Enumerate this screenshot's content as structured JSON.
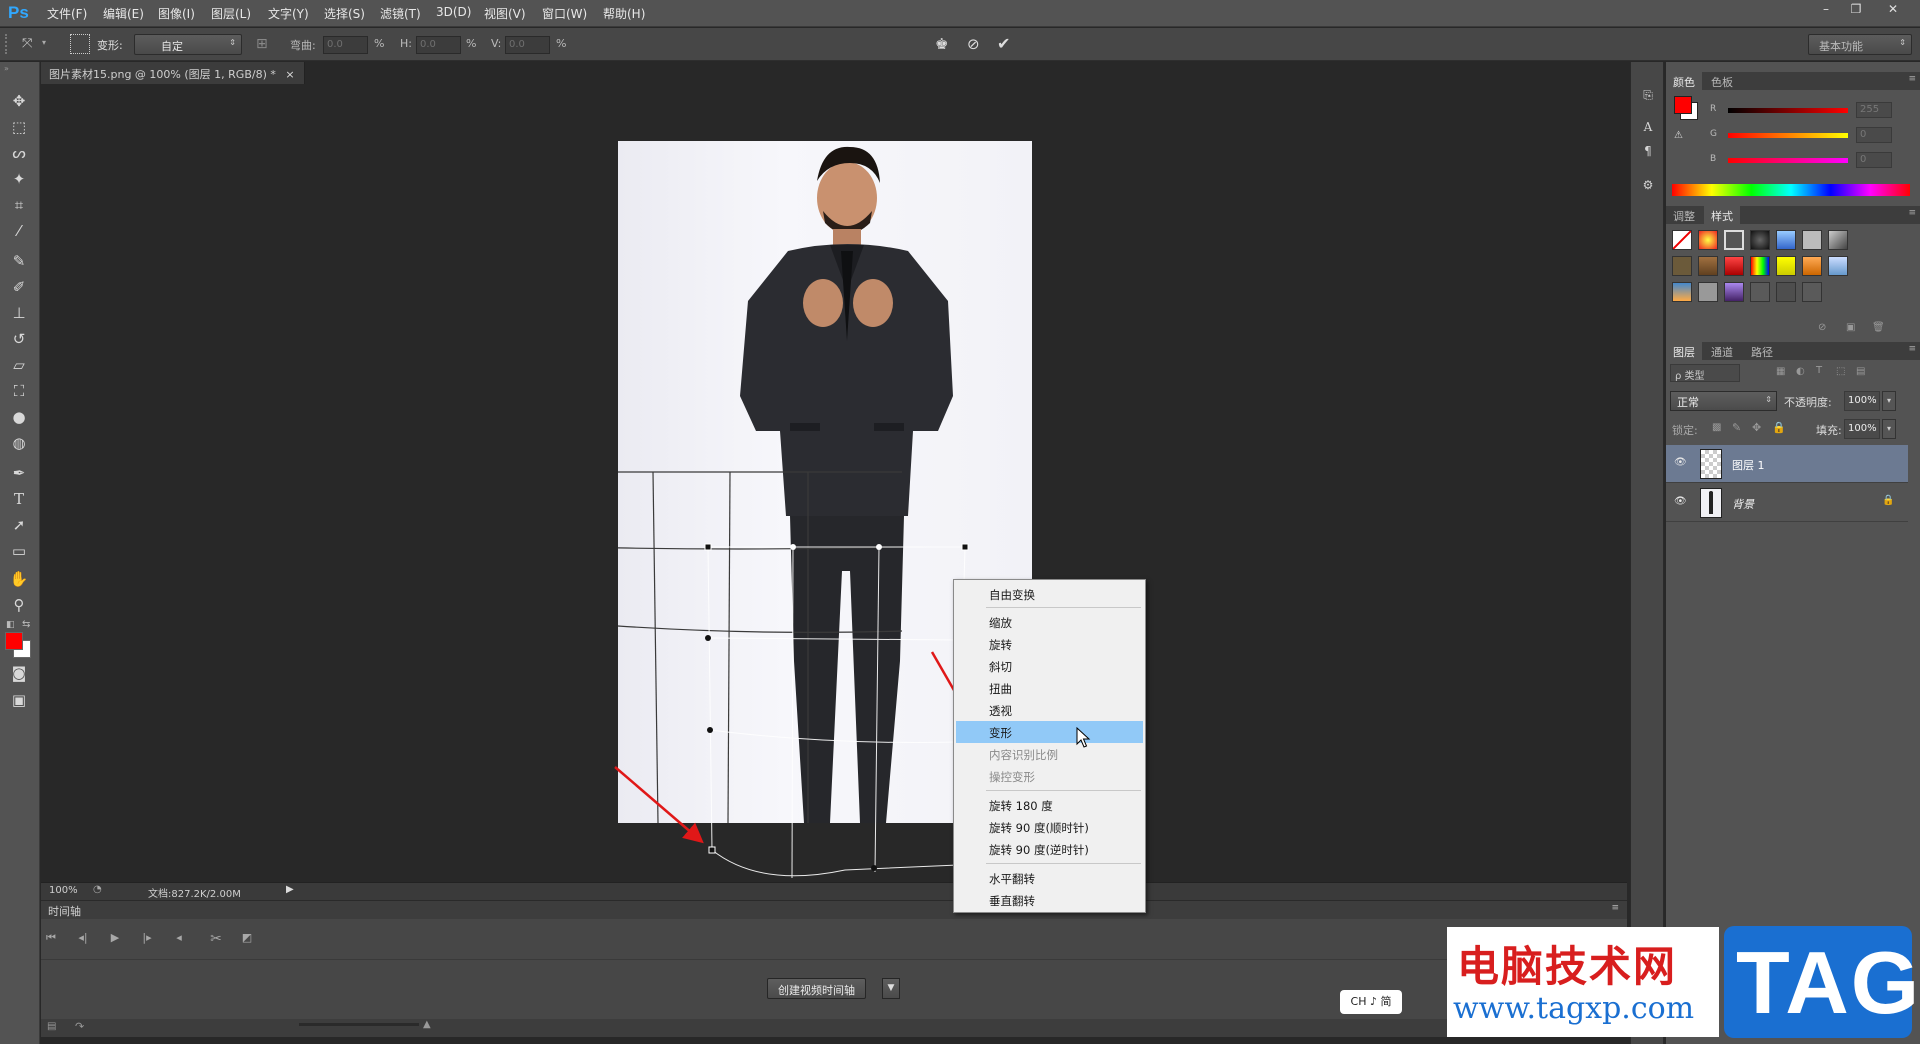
{
  "app": {
    "logo": "Ps"
  },
  "menubar": {
    "items": [
      "文件(F)",
      "编辑(E)",
      "图像(I)",
      "图层(L)",
      "文字(Y)",
      "选择(S)",
      "滤镜(T)",
      "3D(D)",
      "视图(V)",
      "窗口(W)",
      "帮助(H)"
    ],
    "window_controls": [
      "–",
      "❐",
      "✕"
    ]
  },
  "options": {
    "transform_label": "变形:",
    "transform_value": "自定",
    "bend_label": "弯曲:",
    "bend_value": "0.0",
    "percent": "%",
    "h_label": "H:",
    "h_value": "0.0",
    "v_label": "V:",
    "v_value": "0.0",
    "workspace": "基本功能"
  },
  "document": {
    "tab_title": "图片素材15.png @ 100% (图层 1, RGB/8) *",
    "tab_close": "×",
    "zoom": "100%",
    "doc_size": "文档:827.2K/2.00M"
  },
  "timeline": {
    "title": "时间轴",
    "create_button": "创建视频时间轴"
  },
  "color_panel": {
    "tabs": [
      "颜色",
      "色板"
    ],
    "channels": [
      {
        "name": "R",
        "value": "255"
      },
      {
        "name": "G",
        "value": "0"
      },
      {
        "name": "B",
        "value": "0"
      }
    ],
    "fg_color": "#ff0000",
    "bg_color": "#ffffff"
  },
  "styles_panel": {
    "tabs": [
      "调整",
      "样式"
    ]
  },
  "layers_panel": {
    "tabs": [
      "图层",
      "通道",
      "路径"
    ],
    "filter_label": "ρ 类型",
    "blend_mode": "正常",
    "opacity_label": "不透明度:",
    "opacity_value": "100%",
    "lock_label": "锁定:",
    "fill_label": "填充:",
    "fill_value": "100%",
    "layers": [
      {
        "name": "图层 1",
        "selected": true
      },
      {
        "name": "背景",
        "selected": false,
        "locked": true
      }
    ]
  },
  "context_menu": {
    "items": [
      {
        "label": "自由变换",
        "disabled": false
      },
      {
        "label": "缩放",
        "disabled": false
      },
      {
        "label": "旋转",
        "disabled": false
      },
      {
        "label": "斜切",
        "disabled": false
      },
      {
        "label": "扭曲",
        "disabled": false
      },
      {
        "label": "透视",
        "disabled": false
      },
      {
        "label": "变形",
        "disabled": false,
        "hover": true
      },
      {
        "label": "内容识别比例",
        "disabled": true
      },
      {
        "label": "操控变形",
        "disabled": true
      },
      {
        "label": "旋转 180 度",
        "disabled": false
      },
      {
        "label": "旋转 90 度(顺时针)",
        "disabled": false
      },
      {
        "label": "旋转 90 度(逆时针)",
        "disabled": false
      },
      {
        "label": "水平翻转",
        "disabled": false
      },
      {
        "label": "垂直翻转",
        "disabled": false
      }
    ]
  },
  "ime": {
    "label": "CH ♪ 简"
  },
  "watermark": {
    "title": "电脑技术网",
    "url": "www.tagxp.com",
    "tag": "TAG"
  }
}
